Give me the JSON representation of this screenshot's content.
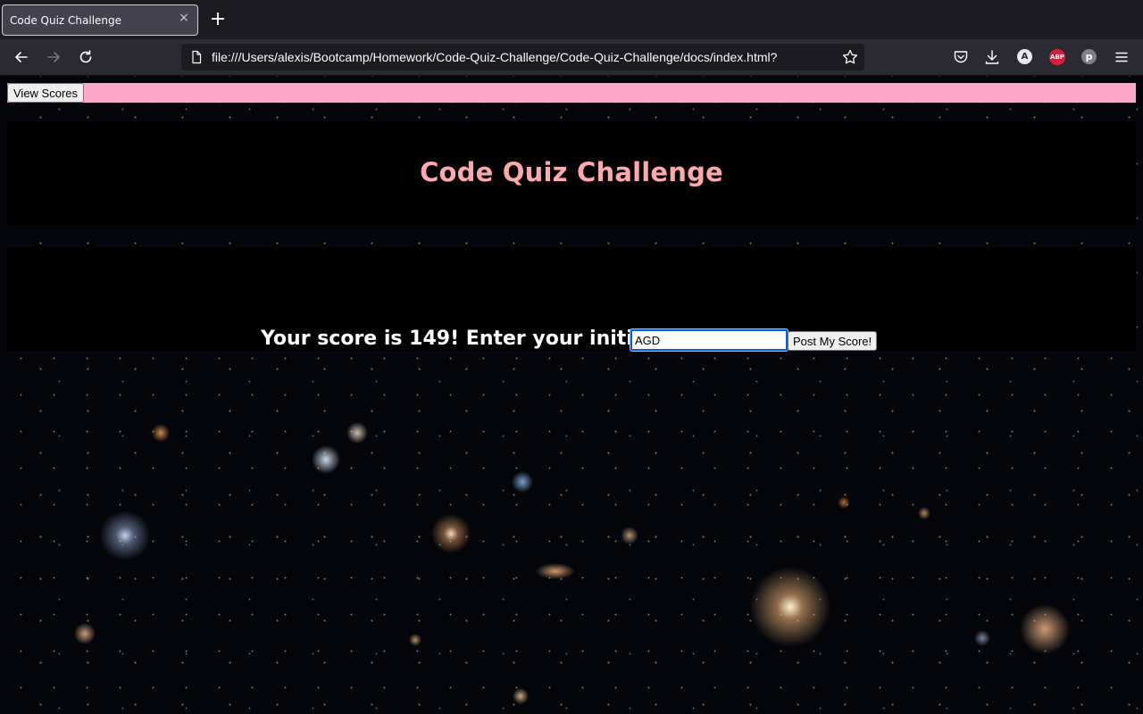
{
  "browser": {
    "tab_title": "Code Quiz Challenge",
    "tab_close_icon": "close-icon",
    "new_tab_icon": "plus-icon",
    "url": "file:///Users/alexis/Bootcamp/Homework/Code-Quiz-Challenge/Code-Quiz-Challenge/docs/index.html?",
    "account_initial": "A",
    "adblock_label": "ABP",
    "pinterest_label": "p"
  },
  "page": {
    "view_scores_label": "View Scores",
    "title": "Code Quiz Challenge",
    "score_prompt": "Your score is 149! Enter your initials:",
    "initials_value": "AGD",
    "post_button_label": "Post My Score!"
  },
  "colors": {
    "topbar": "#ffa8c7",
    "title": "#ffa8ad",
    "panel": "#000000"
  }
}
